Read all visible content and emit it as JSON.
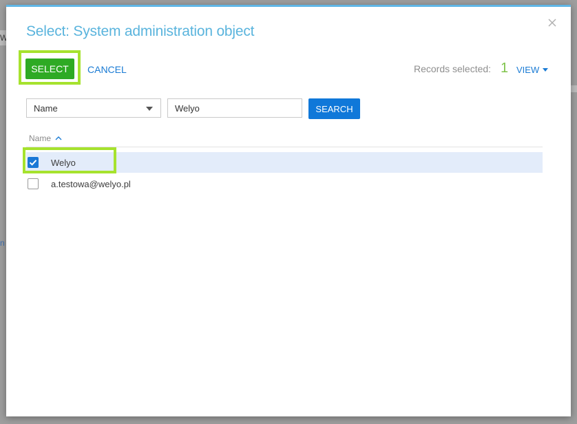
{
  "background": {
    "partial_text_left": "W",
    "partial_text_link": "n"
  },
  "dialog": {
    "title": "Select: System administration object",
    "close_icon": "close-icon"
  },
  "toolbar": {
    "select_label": "SELECT",
    "cancel_label": "CANCEL",
    "records_selected_label": "Records selected:",
    "records_selected_count": "1",
    "view_label": "VIEW"
  },
  "search": {
    "column_selected": "Name",
    "query_value": "Welyo",
    "search_label": "SEARCH"
  },
  "grid": {
    "column_header": "Name",
    "sort": "ascending",
    "rows": [
      {
        "label": "Welyo",
        "checked": true
      },
      {
        "label": "a.testowa@welyo.pl",
        "checked": false
      }
    ]
  },
  "colors": {
    "title": "#5ab4dd",
    "select_button": "#2eaa24",
    "search_button": "#1078d9",
    "highlight": "#a6e22e",
    "selected_row": "#e3ecfa"
  }
}
